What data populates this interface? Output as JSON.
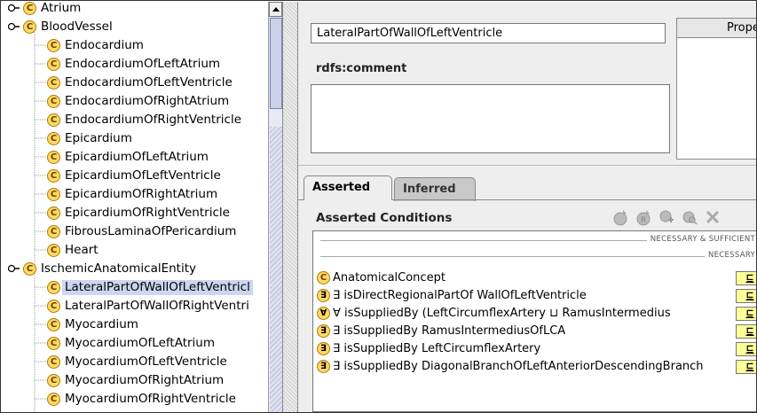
{
  "tree": {
    "items": [
      {
        "label": "Atrium",
        "depth": 0,
        "expandable": true
      },
      {
        "label": "BloodVessel",
        "depth": 0,
        "expandable": true
      },
      {
        "label": "Endocardium",
        "depth": 1,
        "expandable": false
      },
      {
        "label": "EndocardiumOfLeftAtrium",
        "depth": 1,
        "expandable": false
      },
      {
        "label": "EndocardiumOfLeftVentricle",
        "depth": 1,
        "expandable": false
      },
      {
        "label": "EndocardiumOfRightAtrium",
        "depth": 1,
        "expandable": false
      },
      {
        "label": "EndocardiumOfRightVentricle",
        "depth": 1,
        "expandable": false
      },
      {
        "label": "Epicardium",
        "depth": 1,
        "expandable": false
      },
      {
        "label": "EpicardiumOfLeftAtrium",
        "depth": 1,
        "expandable": false
      },
      {
        "label": "EpicardiumOfLeftVentricle",
        "depth": 1,
        "expandable": false
      },
      {
        "label": "EpicardiumOfRightAtrium",
        "depth": 1,
        "expandable": false
      },
      {
        "label": "EpicardiumOfRightVentricle",
        "depth": 1,
        "expandable": false
      },
      {
        "label": "FibrousLaminaOfPericardium",
        "depth": 1,
        "expandable": false
      },
      {
        "label": "Heart",
        "depth": 1,
        "expandable": false
      },
      {
        "label": "IschemicAnatomicalEntity",
        "depth": 0,
        "expandable": true
      },
      {
        "label": "LateralPartOfWallOfLeftVentricl",
        "depth": 1,
        "expandable": false,
        "selected": true
      },
      {
        "label": "LateralPartOfWallOfRightVentri",
        "depth": 1,
        "expandable": false
      },
      {
        "label": "Myocardium",
        "depth": 1,
        "expandable": false
      },
      {
        "label": "MyocardiumOfLeftAtrium",
        "depth": 1,
        "expandable": false
      },
      {
        "label": "MyocardiumOfLeftVentricle",
        "depth": 1,
        "expandable": false
      },
      {
        "label": "MyocardiumOfRightAtrium",
        "depth": 1,
        "expandable": false
      },
      {
        "label": "MyocardiumOfRightVentricle",
        "depth": 1,
        "expandable": false
      }
    ],
    "class_icon_glyph": "C"
  },
  "editor": {
    "class_name": "LateralPartOfWallOfLeftVentricle",
    "comment_label": "rdfs:comment",
    "comment_value": "",
    "properties_header": "Prope"
  },
  "tabs": [
    {
      "label": "Asserted",
      "active": true
    },
    {
      "label": "Inferred",
      "active": false
    }
  ],
  "conditions": {
    "title": "Asserted Conditions",
    "section_necessary_sufficient": "NECESSARY & SUFFICIENT",
    "section_necessary": "NECESSARY",
    "subclass_symbol": "⊑",
    "rows": [
      {
        "icon": "named",
        "glyph": "C",
        "text": "AnatomicalConcept"
      },
      {
        "icon": "exist",
        "glyph": "∃",
        "text": "∃ isDirectRegionalPartOf WallOfLeftVentricle"
      },
      {
        "icon": "univ",
        "glyph": "∀",
        "text": "∀ isSuppliedBy (LeftCircumflexArtery ⊔ RamusIntermedius"
      },
      {
        "icon": "exist",
        "glyph": "∃",
        "text": "∃ isSuppliedBy RamusIntermediusOfLCA"
      },
      {
        "icon": "exist",
        "glyph": "∃",
        "text": "∃ isSuppliedBy LeftCircumflexArtery"
      },
      {
        "icon": "exist",
        "glyph": "∃",
        "text": "∃ isSuppliedBy DiagonalBranchOfLeftAnteriorDescendingBranch"
      }
    ]
  },
  "colors": {
    "selection": "#ccd6f0",
    "class_icon_fill": "#ffd966",
    "subclass_badge": "#ffff99",
    "panel_bg": "#eeeeee"
  }
}
